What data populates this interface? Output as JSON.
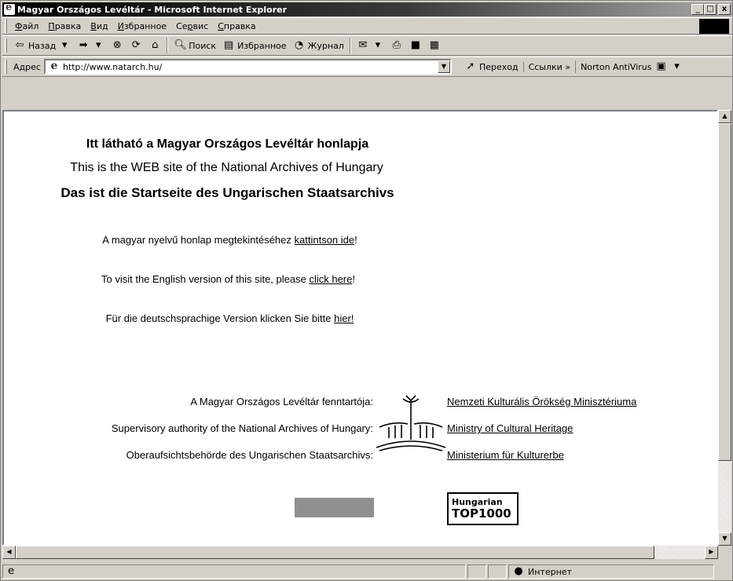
{
  "window": {
    "title": "Magyar Országos Levéltár - Microsoft Internet Explorer"
  },
  "title_buttons": {
    "minimize": "_",
    "maximize": "□",
    "close": "x"
  },
  "menu": [
    {
      "u": "Ф",
      "rest": "айл"
    },
    {
      "u": "П",
      "rest": "равка"
    },
    {
      "u": "В",
      "rest": "ид"
    },
    {
      "u": "И",
      "rest": "збранное"
    },
    {
      "pre": "Се",
      "u": "р",
      "rest": "вис"
    },
    {
      "u": "С",
      "rest": "правка"
    }
  ],
  "toolbar": {
    "back": "Назад",
    "search": "Поиск",
    "favorites": "Избранное",
    "history": "Журнал"
  },
  "address": {
    "label": "Адрес",
    "value": "http://www.natarch.hu/",
    "go": "Переход",
    "links": "Ссылки",
    "chevron": "»",
    "norton": "Norton AntiVirus"
  },
  "page": {
    "h1": "Itt látható a Magyar Országos Levéltár honlapja",
    "h2": "This is the WEB site of the National Archives of Hungary",
    "h3": "Das ist die Startseite des Ungarischen Staatsarchivs",
    "hu_text": "A magyar nyelvű honlap megtekintéséhez ",
    "hu_link": "kattintson ide",
    "en_text": "To visit the English version of this site, please ",
    "en_link": "click here",
    "de_text": "Für die deutschsprachige Version klicken Sie bitte ",
    "de_link": "hier!",
    "excl": "!"
  },
  "supervisory": {
    "hu_label": "A Magyar Országos Levéltár fenntartója:",
    "en_label": "Supervisory authority of the National Archives of Hungary:",
    "de_label": "Oberaufsichtsbehörde des Ungarischen Staatsarchivs:",
    "hu_link": "Nemzeti Kulturális Örökség Minisztériuma",
    "en_link": "Ministry of Cultural Heritage",
    "de_link": "Ministerium für Kulturerbe"
  },
  "badge": {
    "line1": "Hungarian",
    "line2": "TOP1000"
  },
  "status": {
    "zone": "Интернет"
  }
}
